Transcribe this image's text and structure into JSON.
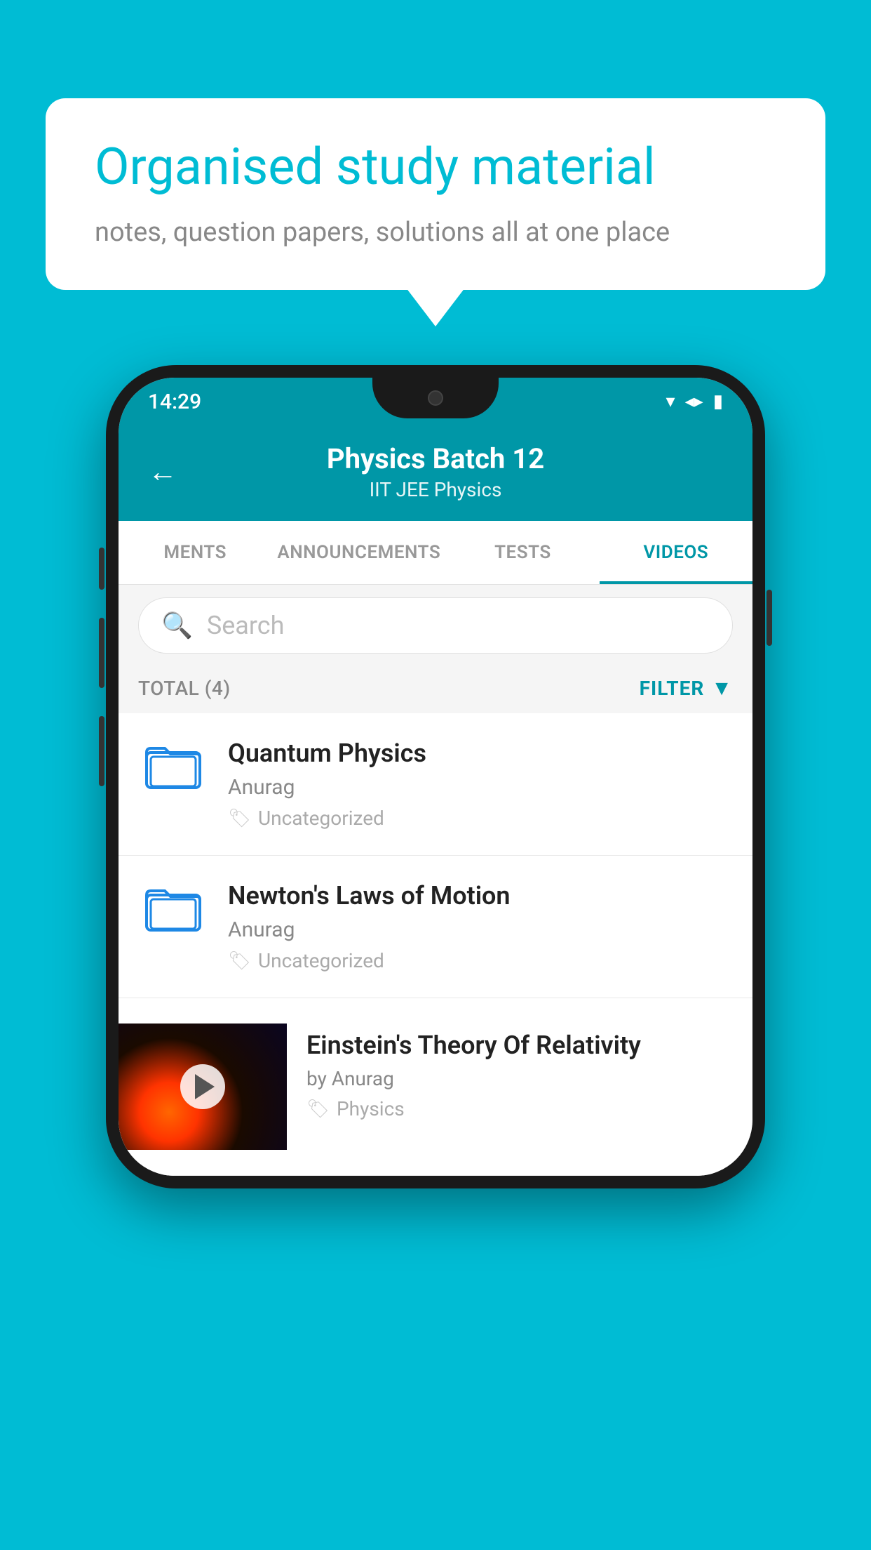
{
  "background_color": "#00bcd4",
  "speech_bubble": {
    "title": "Organised study material",
    "subtitle": "notes, question papers, solutions all at one place"
  },
  "phone": {
    "status_bar": {
      "time": "14:29",
      "icons": [
        "wifi",
        "signal",
        "battery"
      ]
    },
    "header": {
      "back_label": "←",
      "title": "Physics Batch 12",
      "subtitle": "IIT JEE   Physics"
    },
    "tabs": [
      {
        "label": "MENTS",
        "active": false
      },
      {
        "label": "ANNOUNCEMENTS",
        "active": false
      },
      {
        "label": "TESTS",
        "active": false
      },
      {
        "label": "VIDEOS",
        "active": true
      }
    ],
    "search": {
      "placeholder": "Search"
    },
    "filter_row": {
      "total_label": "TOTAL (4)",
      "filter_label": "FILTER"
    },
    "videos": [
      {
        "id": 1,
        "title": "Quantum Physics",
        "author": "Anurag",
        "tag": "Uncategorized",
        "type": "folder"
      },
      {
        "id": 2,
        "title": "Newton's Laws of Motion",
        "author": "Anurag",
        "tag": "Uncategorized",
        "type": "folder"
      },
      {
        "id": 3,
        "title": "Einstein's Theory Of Relativity",
        "author": "by Anurag",
        "tag": "Physics",
        "type": "video"
      }
    ]
  }
}
